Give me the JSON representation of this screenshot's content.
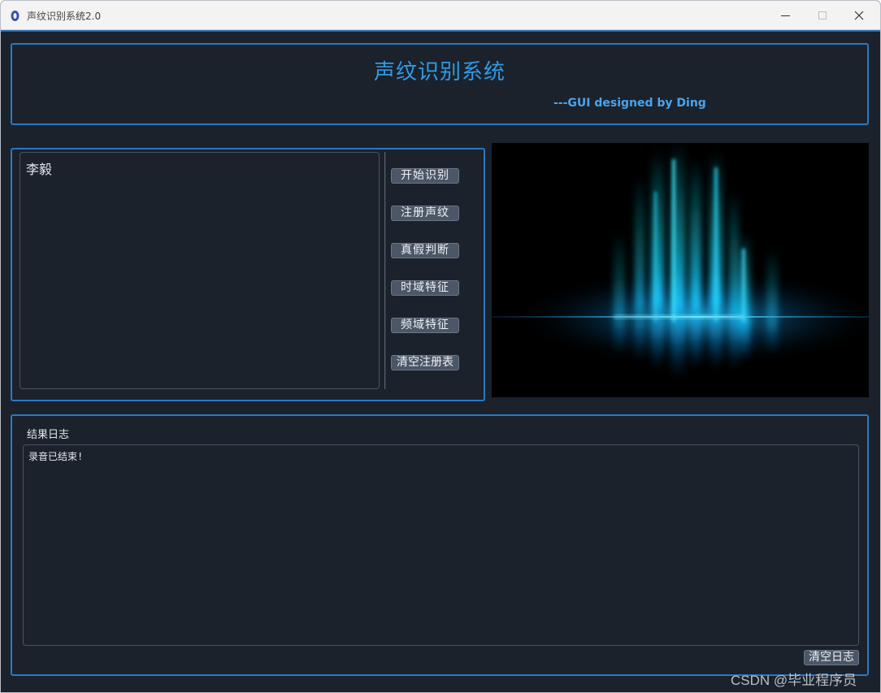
{
  "window": {
    "title": "声纹识别系统2.0"
  },
  "header": {
    "title": "声纹识别系统",
    "subtitle": "---GUI designed by Ding"
  },
  "user_list": {
    "items": [
      "李毅"
    ]
  },
  "actions": {
    "start_recognition": "开始识别",
    "register_voiceprint": "注册声纹",
    "authenticity_check": "真假判断",
    "time_domain": "时域特征",
    "frequency_domain": "频域特征",
    "clear_registry": "清空注册表"
  },
  "log": {
    "label": "结果日志",
    "content": "录音已结束!",
    "clear_button": "清空日志"
  },
  "watermark": "CSDN @毕业程序员",
  "colors": {
    "background": "#1b222c",
    "panel_border": "#2b78c2",
    "title_accent": "#2f9ae6",
    "button_bg": "#4b5666"
  }
}
